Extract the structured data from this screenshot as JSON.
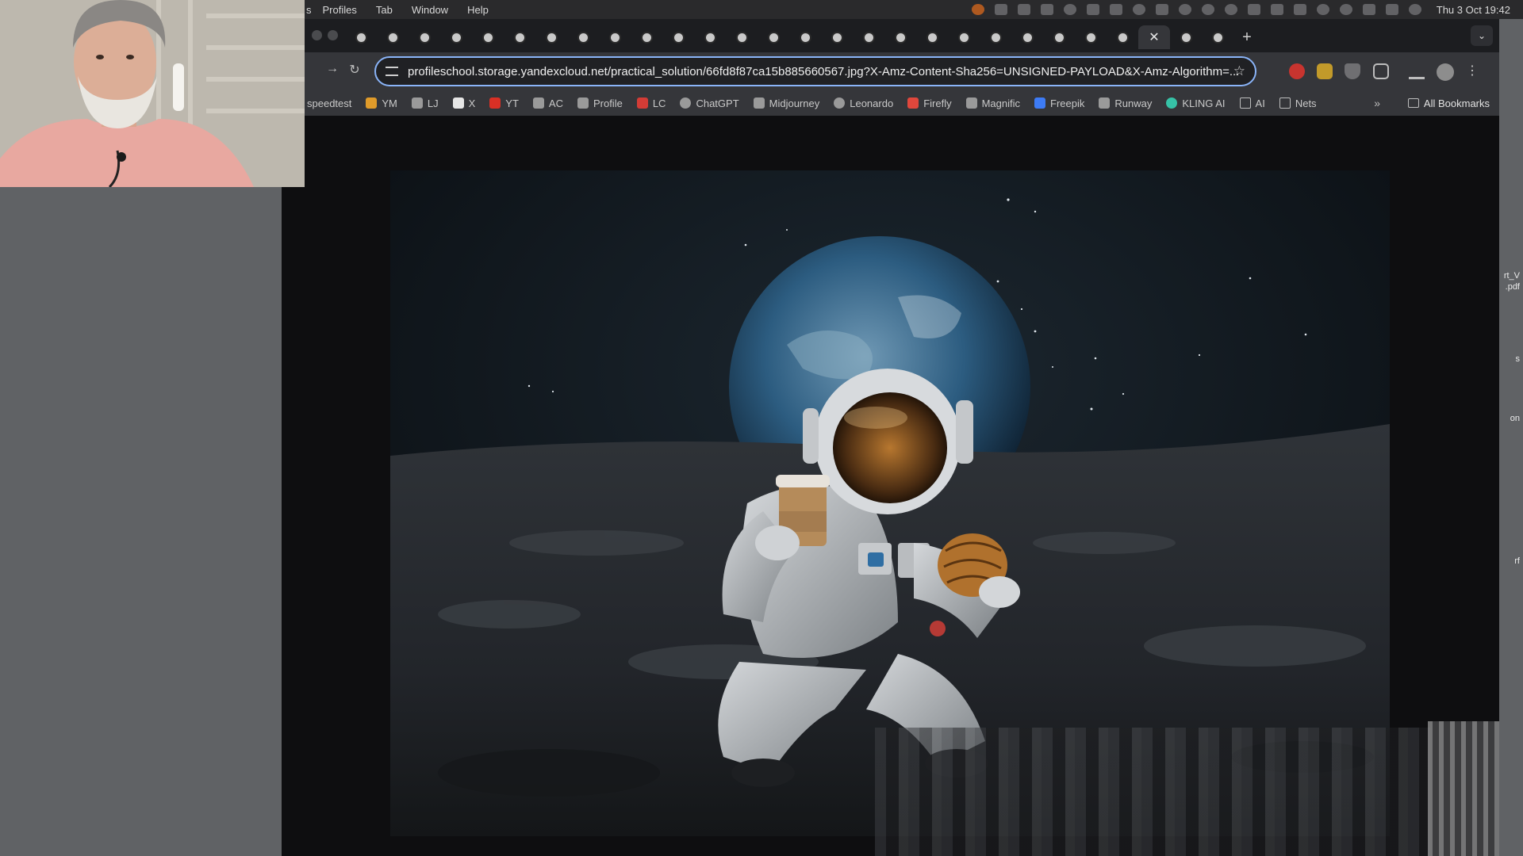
{
  "menubar": {
    "items": [
      "s",
      "Profiles",
      "Tab",
      "Window",
      "Help"
    ],
    "clock": "Thu 3 Oct  19:42"
  },
  "browser": {
    "address_bar": {
      "url": "profileschool.storage.yandexcloud.net/practical_solution/66fd8f87ca15b885660567.jpg?X-Amz-Content-Sha256=UNSIGNED-PAYLOAD&X-Amz-Algorithm=..."
    },
    "tab_close_glyph": "✕",
    "new_tab_glyph": "+",
    "tab_search_glyph": "⌄",
    "bookmarks": [
      {
        "label": "speedtest",
        "icon": "none"
      },
      {
        "label": "YM",
        "icon": "ym-icon"
      },
      {
        "label": "LJ",
        "icon": "lj-icon"
      },
      {
        "label": "X",
        "icon": "x-icon"
      },
      {
        "label": "YT",
        "icon": "youtube-icon"
      },
      {
        "label": "AC",
        "icon": "ac-icon"
      },
      {
        "label": "Profile",
        "icon": "profile-icon"
      },
      {
        "label": "LC",
        "icon": "lc-icon"
      },
      {
        "label": "ChatGPT",
        "icon": "chatgpt-icon"
      },
      {
        "label": "Midjourney",
        "icon": "midjourney-icon"
      },
      {
        "label": "Leonardo",
        "icon": "leonardo-icon"
      },
      {
        "label": "Firefly",
        "icon": "firefly-icon"
      },
      {
        "label": "Magnific",
        "icon": "magnific-icon"
      },
      {
        "label": "Freepik",
        "icon": "freepik-icon"
      },
      {
        "label": "Runway",
        "icon": "runway-icon"
      },
      {
        "label": "KLING AI",
        "icon": "kling-icon"
      },
      {
        "label": "AI",
        "icon": "folder-icon"
      },
      {
        "label": "Nets",
        "icon": "folder-icon"
      }
    ],
    "bookmarks_overflow": "»",
    "all_bookmarks": "All Bookmarks"
  },
  "desktop_labels": [
    "rt_V",
    ".pdf",
    "s",
    "on",
    "rf"
  ],
  "colors": {
    "omnibox_focus": "#8ab4f8",
    "toolbar": "#35363a",
    "tabstrip": "#1c1d20"
  }
}
